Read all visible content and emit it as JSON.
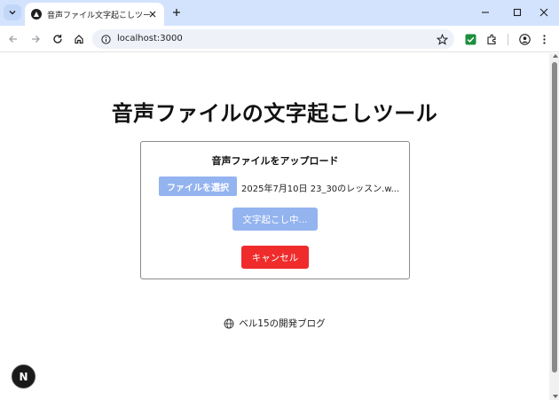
{
  "browser": {
    "tab_title": "音声ファイル文字起こしツール",
    "url": "localhost:3000"
  },
  "page": {
    "title": "音声ファイルの文字起こしツール",
    "card": {
      "heading": "音声ファイルをアップロード",
      "file_button_label": "ファイルを選択",
      "file_name": "2025年7月10日 23_30のレッスン.w...",
      "transcribe_button_label": "文字起こし中...",
      "cancel_button_label": "キャンセル"
    },
    "footer_link": "ベル15の開発ブログ",
    "next_badge_label": "N"
  },
  "colors": {
    "tabstrip": "#d3e3fd",
    "disabled_button": "#94b4f0",
    "cancel_button": "#ef2b2b",
    "extension_check": "#1e8e3e"
  },
  "icons": [
    "tab-search-icon",
    "favicon-icon",
    "close-icon",
    "plus-icon",
    "minimize-icon",
    "maximize-icon",
    "window-close-icon",
    "back-icon",
    "forward-icon",
    "reload-icon",
    "home-icon",
    "info-icon",
    "star-icon",
    "extension-check-icon",
    "puzzle-icon",
    "profile-icon",
    "menu-icon",
    "globe-icon"
  ]
}
